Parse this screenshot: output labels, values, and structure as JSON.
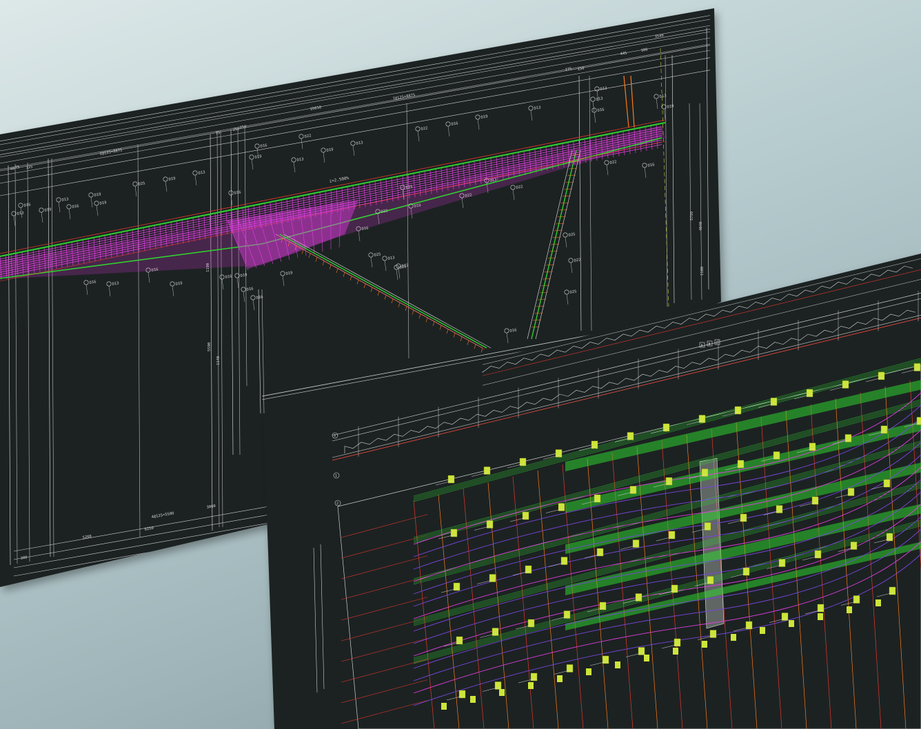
{
  "colors": {
    "background_light": "#dde8e8",
    "background_dark": "#7e9599",
    "sheet": "#1f2224",
    "line_white": "#d8d8d8",
    "magenta": "#e03ee0",
    "green": "#2fd12f",
    "red": "#e8372c",
    "orange": "#ff7a1a",
    "yellow": "#d8e63a",
    "purple": "#7a45e0"
  },
  "drawing_1": {
    "dimensions_top": [
      "3540",
      "445",
      "300",
      "175",
      "150",
      "16010",
      "7@125=8875",
      "75",
      "250",
      "250",
      "2@125=8875",
      "40",
      "75",
      "125"
    ],
    "dimensions_right": [
      "5799",
      "4040",
      "1100"
    ],
    "dimensions_bottom": [
      "4@125=5500",
      "3000",
      "5200",
      "6250",
      "300"
    ],
    "dimensions_left": [
      "5500",
      "1140",
      "1190"
    ],
    "slope_note": "i=2.500%",
    "rebar_left": [
      "D16",
      "D13",
      "D19",
      "D25",
      "D19",
      "D13",
      "D16",
      "D13",
      "D16",
      "D19",
      "D16",
      "D16",
      "D19",
      "D13",
      "D19",
      "D16",
      "D19"
    ],
    "rebar_mid": [
      "D16",
      "D22",
      "D13",
      "D19",
      "D13",
      "D16",
      "D19",
      "D16",
      "D19",
      "D16",
      "D22",
      "D19",
      "D13",
      "D22",
      "D25",
      "D25",
      "D22",
      "D16"
    ],
    "rebar_right": [
      "D13",
      "D19",
      "D13",
      "D13",
      "D16",
      "D13",
      "D19",
      "D22",
      "D16",
      "D22",
      "D13",
      "D22",
      "D22",
      "D25",
      "D25",
      "D16",
      "D25"
    ]
  },
  "drawing_2": {
    "axis_labels": [
      "1",
      "2",
      "3"
    ],
    "tags": [
      "A",
      "B",
      "C"
    ]
  }
}
